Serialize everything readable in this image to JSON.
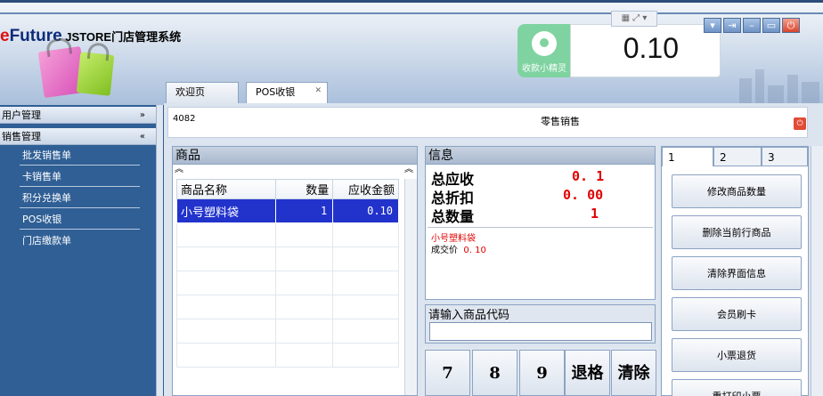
{
  "app": {
    "logo_brand_e": "e",
    "logo_brand_rest": "Future",
    "logo_text": " JSTORE门店管理系统"
  },
  "cashier_widget": {
    "label": "收款小精灵",
    "amount": "0.10"
  },
  "window_icons": [
    "grid-icon",
    "expand-icon",
    "chevron-down-icon"
  ],
  "tabs": [
    {
      "label": "欢迎页",
      "active": false
    },
    {
      "label": "POS收银",
      "active": true,
      "close": "✕"
    }
  ],
  "sidebar": {
    "groups": [
      {
        "label": "用户管理",
        "chevron": "»"
      },
      {
        "label": "销售管理",
        "chevron": "«"
      }
    ],
    "items": [
      {
        "label": "批发销售单"
      },
      {
        "label": "卡销售单"
      },
      {
        "label": "积分兑换单"
      },
      {
        "label": "POS收银"
      },
      {
        "label": "门店缴款单"
      }
    ]
  },
  "header": {
    "code": "4082",
    "title": "零售销售"
  },
  "goods": {
    "title": "商品",
    "columns": [
      "商品名称",
      "数量",
      "应收金额"
    ],
    "rows": [
      {
        "name": "小号塑料袋",
        "qty": "1",
        "amount": "0.10"
      }
    ]
  },
  "info": {
    "title": "信息",
    "total_receivable_label": "总应收",
    "total_receivable": "0. 1",
    "total_discount_label": "总折扣",
    "total_discount": "0. 00",
    "total_qty_label": "总数量",
    "total_qty": "1",
    "detail_name": "小号塑料袋",
    "detail_price_label": "成交价",
    "detail_price": "0. 10"
  },
  "input": {
    "label": "请输入商品代码",
    "value": ""
  },
  "keypad": [
    "7",
    "8",
    "9",
    "退格",
    "清除"
  ],
  "right_tabs": [
    "1",
    "2",
    "3"
  ],
  "actions": [
    "修改商品数量",
    "删除当前行商品",
    "清除界面信息",
    "会员刷卡",
    "小票退货",
    "重打印小票"
  ]
}
